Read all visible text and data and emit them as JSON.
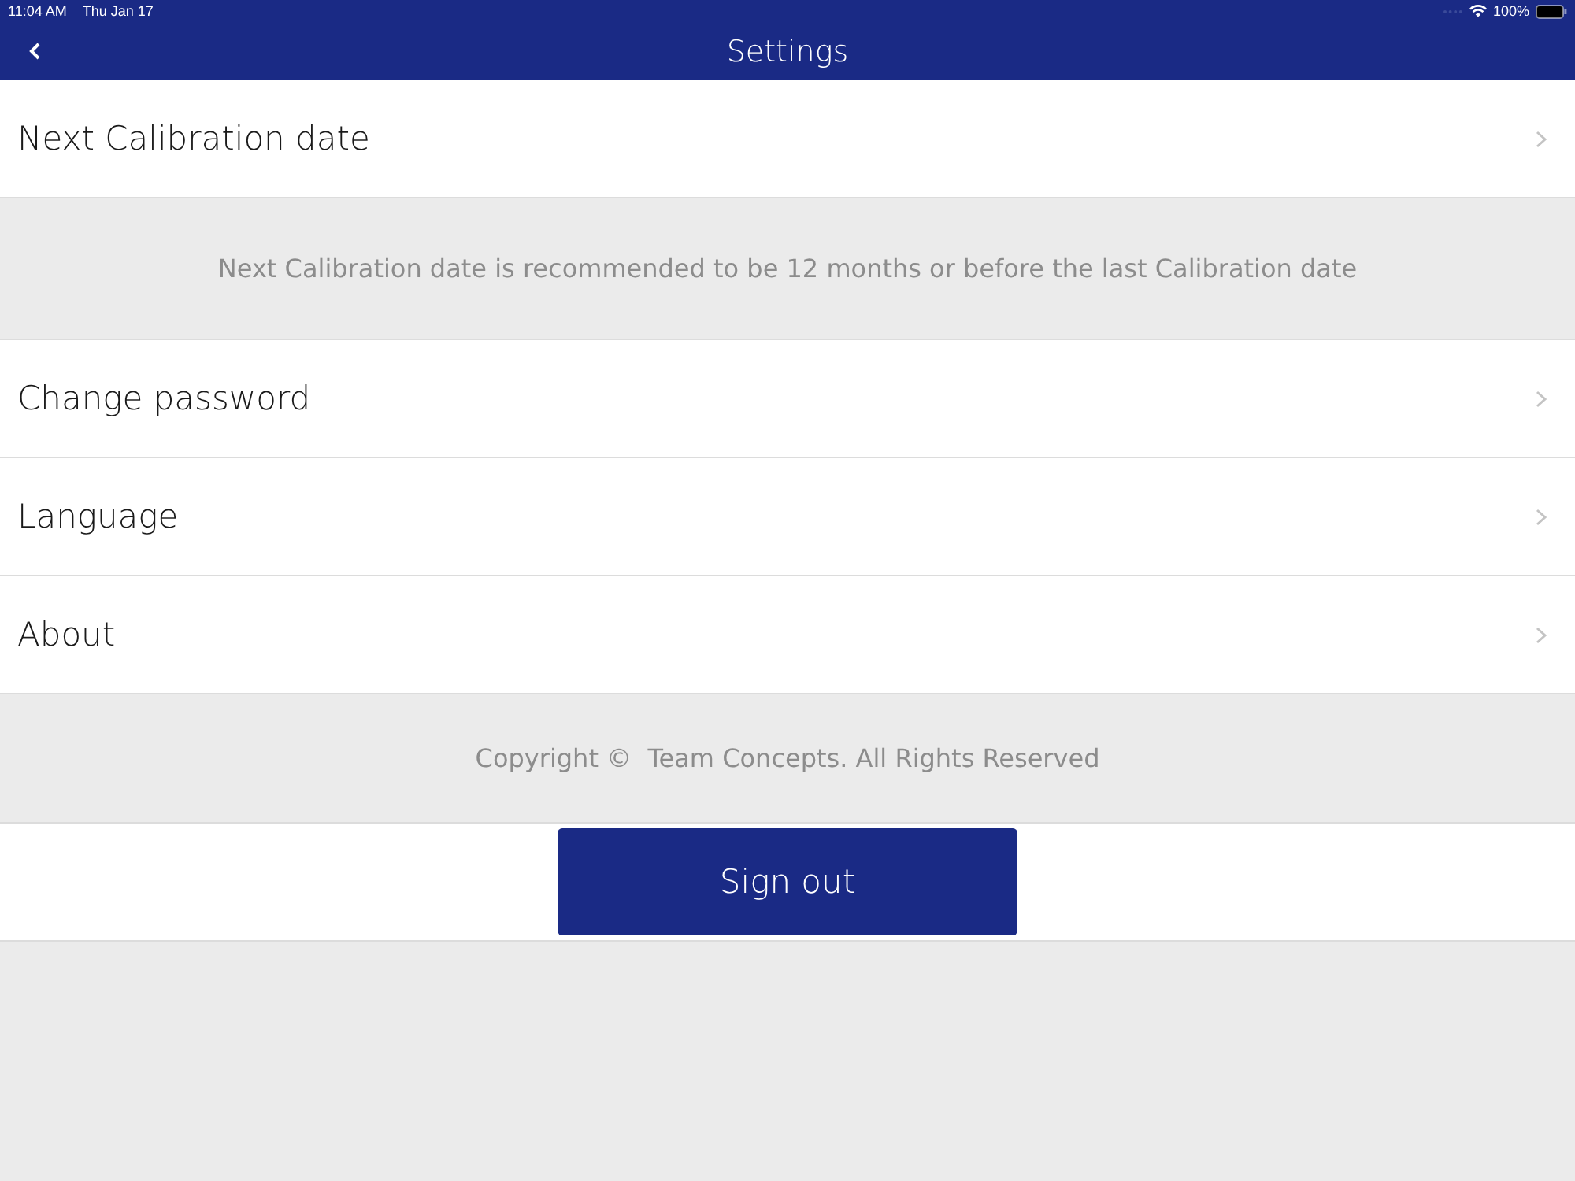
{
  "status_bar": {
    "time": "11:04 AM",
    "date": "Thu Jan 17",
    "battery": "100%"
  },
  "nav_bar": {
    "title": "Settings"
  },
  "sections": [
    {
      "kind": "row",
      "label": "Next Calibration date"
    },
    {
      "kind": "note",
      "text": "Next Calibration date is recommended to be 12 months or before the last Calibration date"
    },
    {
      "kind": "row",
      "label": "Change password"
    },
    {
      "kind": "row",
      "label": "Language"
    },
    {
      "kind": "row",
      "label": "About"
    },
    {
      "kind": "footer",
      "text": "Copyright ©  Team Concepts. All Rights Reserved"
    },
    {
      "kind": "button",
      "label": "Sign out"
    }
  ]
}
